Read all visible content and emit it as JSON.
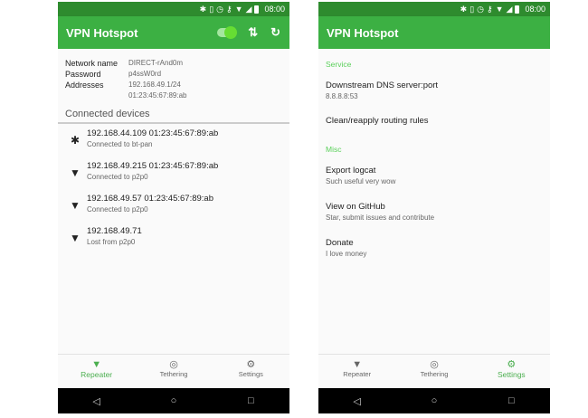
{
  "status_bar": {
    "time": "08:00"
  },
  "colors": {
    "app_bar": "#3cb043",
    "status_bar": "#2e8b2e",
    "accent": "#5bd05b",
    "active_nav": "#4caf50"
  },
  "left": {
    "title": "VPN Hotspot",
    "info": [
      {
        "key": "Network name",
        "value": "DIRECT-rAnd0m"
      },
      {
        "key": "Password",
        "value": "p4ssW0rd"
      },
      {
        "key": "Addresses",
        "value": "192.168.49.1/24",
        "value2": "01:23:45:67:89:ab"
      }
    ],
    "connected_header": "Connected devices",
    "devices": [
      {
        "icon": "bluetooth-icon",
        "line1": "192.168.44.109  01:23:45:67:89:ab",
        "line2": "Connected to bt-pan"
      },
      {
        "icon": "wifi-icon",
        "line1": "192.168.49.215  01:23:45:67:89:ab",
        "line2": "Connected to p2p0"
      },
      {
        "icon": "wifi-icon",
        "line1": "192.168.49.57  01:23:45:67:89:ab",
        "line2": "Connected to p2p0"
      },
      {
        "icon": "wifi-icon",
        "line1": "192.168.49.71",
        "line2": "Lost from p2p0"
      }
    ]
  },
  "right": {
    "title": "VPN Hotspot",
    "service_header": "Service",
    "service_items": [
      {
        "title": "Downstream DNS server:port",
        "subtitle": "8.8.8.8:53"
      },
      {
        "title": "Clean/reapply routing rules",
        "subtitle": ""
      }
    ],
    "misc_header": "Misc",
    "misc_items": [
      {
        "title": "Export logcat",
        "subtitle": "Such useful very wow"
      },
      {
        "title": "View on GitHub",
        "subtitle": "Star, submit issues and contribute"
      },
      {
        "title": "Donate",
        "subtitle": "I love money"
      }
    ]
  },
  "nav": {
    "repeater": "Repeater",
    "tethering": "Tethering",
    "settings": "Settings"
  },
  "left_nav_active": "Repeater",
  "right_nav_active": "Settings"
}
